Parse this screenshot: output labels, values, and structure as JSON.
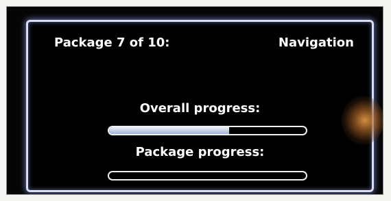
{
  "header": {
    "package_label": "Package 7 of 10:",
    "package_name": "Navigation"
  },
  "progress": {
    "overall_label": "Overall progress:",
    "overall_fraction": 0.61,
    "package_label": "Package progress:",
    "package_fraction": 0.0
  },
  "colors": {
    "background": "#000000",
    "text": "#ffffff",
    "frame_glow": "#9aa6ff",
    "fill": "#b8c8e6"
  }
}
